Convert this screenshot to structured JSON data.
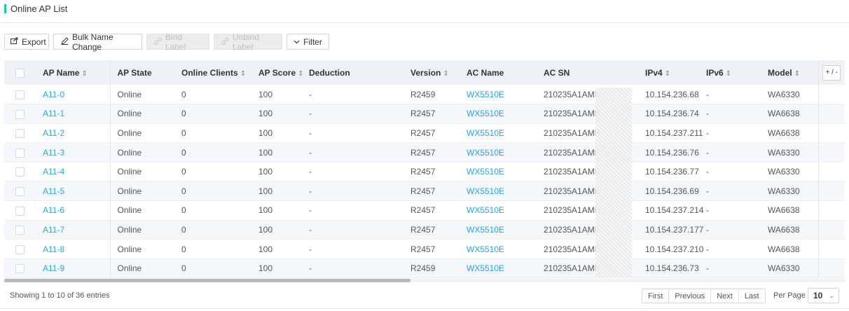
{
  "page": {
    "title": "Online AP List",
    "accent_color": "#1fc5a8",
    "link_color": "#2d9fe0"
  },
  "toolbar": {
    "export_label": "Export",
    "bulk_name_label": "Bulk Name Change",
    "bind_label": "Bind Label",
    "unbind_label": "Unbind Label",
    "filter_label": "Filter"
  },
  "table": {
    "columns": {
      "ap_name": "AP Name",
      "ap_state": "AP State",
      "online_clients": "Online Clients",
      "ap_score": "AP Score",
      "deduction": "Deduction",
      "version": "Version",
      "ac_name": "AC Name",
      "ac_sn": "AC SN",
      "ipv4": "IPv4",
      "ipv6": "IPv6",
      "model": "Model",
      "column_toggle": "+ / -"
    },
    "rows": [
      {
        "ap_name": "A11-0",
        "ap_state": "Online",
        "online_clients": "0",
        "ap_score": "100",
        "deduction": "-",
        "version": "R2459",
        "ac_name": "WX5510E",
        "ac_sn": "210235A1AMB",
        "ipv4": "10.154.236.68",
        "ipv6": "-",
        "model": "WA6330"
      },
      {
        "ap_name": "A11-1",
        "ap_state": "Online",
        "online_clients": "0",
        "ap_score": "100",
        "deduction": "-",
        "version": "R2457",
        "ac_name": "WX5510E",
        "ac_sn": "210235A1AMB",
        "ipv4": "10.154.236.74",
        "ipv6": "-",
        "model": "WA6638"
      },
      {
        "ap_name": "A11-2",
        "ap_state": "Online",
        "online_clients": "0",
        "ap_score": "100",
        "deduction": "-",
        "version": "R2457",
        "ac_name": "WX5510E",
        "ac_sn": "210235A1AMB",
        "ipv4": "10.154.237.211",
        "ipv6": "-",
        "model": "WA6638"
      },
      {
        "ap_name": "A11-3",
        "ap_state": "Online",
        "online_clients": "0",
        "ap_score": "100",
        "deduction": "-",
        "version": "R2457",
        "ac_name": "WX5510E",
        "ac_sn": "210235A1AMB",
        "ipv4": "10.154.236.76",
        "ipv6": "-",
        "model": "WA6330"
      },
      {
        "ap_name": "A11-4",
        "ap_state": "Online",
        "online_clients": "0",
        "ap_score": "100",
        "deduction": "-",
        "version": "R2457",
        "ac_name": "WX5510E",
        "ac_sn": "210235A1AMB",
        "ipv4": "10.154.236.77",
        "ipv6": "-",
        "model": "WA6330"
      },
      {
        "ap_name": "A11-5",
        "ap_state": "Online",
        "online_clients": "0",
        "ap_score": "100",
        "deduction": "-",
        "version": "R2457",
        "ac_name": "WX5510E",
        "ac_sn": "210235A1AMB",
        "ipv4": "10.154.236.69",
        "ipv6": "-",
        "model": "WA6330"
      },
      {
        "ap_name": "A11-6",
        "ap_state": "Online",
        "online_clients": "0",
        "ap_score": "100",
        "deduction": "-",
        "version": "R2457",
        "ac_name": "WX5510E",
        "ac_sn": "210235A1AMB",
        "ipv4": "10.154.237.214",
        "ipv6": "-",
        "model": "WA6638"
      },
      {
        "ap_name": "A11-7",
        "ap_state": "Online",
        "online_clients": "0",
        "ap_score": "100",
        "deduction": "-",
        "version": "R2457",
        "ac_name": "WX5510E",
        "ac_sn": "210235A1AMB",
        "ipv4": "10.154.237.177",
        "ipv6": "-",
        "model": "WA6638"
      },
      {
        "ap_name": "A11-8",
        "ap_state": "Online",
        "online_clients": "0",
        "ap_score": "100",
        "deduction": "-",
        "version": "R2457",
        "ac_name": "WX5510E",
        "ac_sn": "210235A1AMB",
        "ipv4": "10.154.237.210",
        "ipv6": "-",
        "model": "WA6638"
      },
      {
        "ap_name": "A11-9",
        "ap_state": "Online",
        "online_clients": "0",
        "ap_score": "100",
        "deduction": "-",
        "version": "R2459",
        "ac_name": "WX5510E",
        "ac_sn": "210235A1AMB",
        "ipv4": "10.154.236.73",
        "ipv6": "-",
        "model": "WA6330"
      }
    ]
  },
  "footer": {
    "summary": "Showing 1 to 10 of 36 entries",
    "pager": {
      "first": "First",
      "previous": "Previous",
      "next": "Next",
      "last": "Last"
    },
    "per_page_label": "Per Page",
    "per_page_value": "10"
  }
}
